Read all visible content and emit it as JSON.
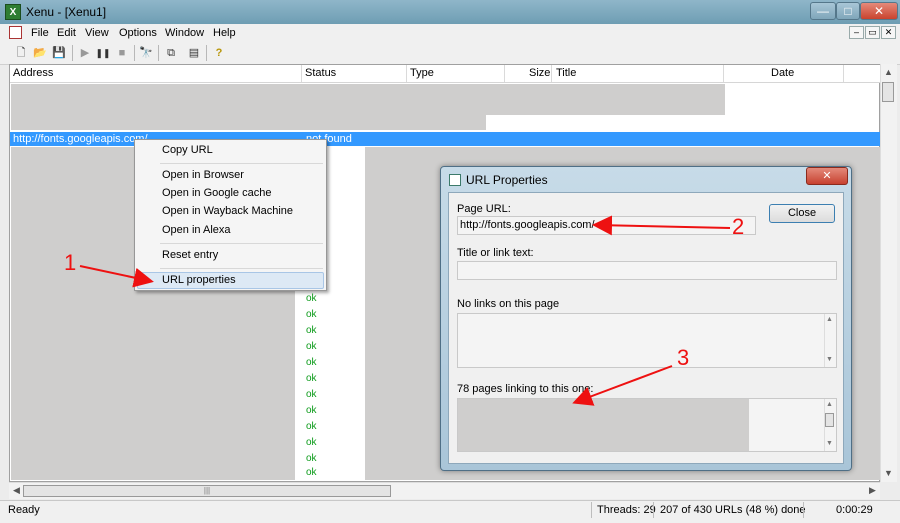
{
  "window": {
    "title": "Xenu - [Xenu1]",
    "app_icon": "xenu-icon",
    "min_glyph": "—",
    "max_glyph": "□",
    "close_glyph": "✕"
  },
  "menu": [
    "File",
    "Edit",
    "View",
    "Options",
    "Window",
    "Help"
  ],
  "mdi_controls": [
    "–",
    "▭",
    "✕"
  ],
  "toolbar": [
    {
      "name": "new-icon",
      "glyph": "🗋"
    },
    {
      "name": "open-icon",
      "glyph": "📂"
    },
    {
      "name": "save-icon",
      "glyph": "💾"
    },
    {
      "name": "play-icon",
      "glyph": "▶"
    },
    {
      "name": "pause-icon",
      "glyph": "❚❚"
    },
    {
      "name": "stop-icon",
      "glyph": "■"
    },
    {
      "name": "find-icon",
      "glyph": "🔭"
    },
    {
      "name": "copy-icon",
      "glyph": "⧉"
    },
    {
      "name": "properties-icon",
      "glyph": "▤"
    },
    {
      "name": "help-icon",
      "glyph": "?"
    }
  ],
  "columns": [
    "Address",
    "Status",
    "Type",
    "Size",
    "Title",
    "Date"
  ],
  "selected_row": {
    "url": "http://fonts.googleapis.com/",
    "status": "not found"
  },
  "ok_label": "ok",
  "context_menu": {
    "copy": "Copy URL",
    "browser": "Open in Browser",
    "google_cache": "Open in Google cache",
    "wayback": "Open in Wayback Machine",
    "alexa": "Open in Alexa",
    "reset": "Reset entry",
    "properties": "URL properties"
  },
  "dialog": {
    "title": "URL Properties",
    "close_button": "Close",
    "close_glyph": "✕",
    "page_url_label": "Page URL:",
    "page_url_value": "http://fonts.googleapis.com/",
    "title_label": "Title or link text:",
    "title_value": "",
    "no_links_label": "No links on this page",
    "linking_label": "78 pages linking to this one:"
  },
  "status_bar": {
    "state": "Ready",
    "threads": "Threads: 29",
    "progress": "207 of 430 URLs (48 %) done",
    "elapsed": "0:00:29"
  },
  "annotations": [
    "1",
    "2",
    "3"
  ],
  "colors": {
    "selection": "#3399ff",
    "ok_text": "#0a9a18",
    "arrow": "#ee1111"
  }
}
